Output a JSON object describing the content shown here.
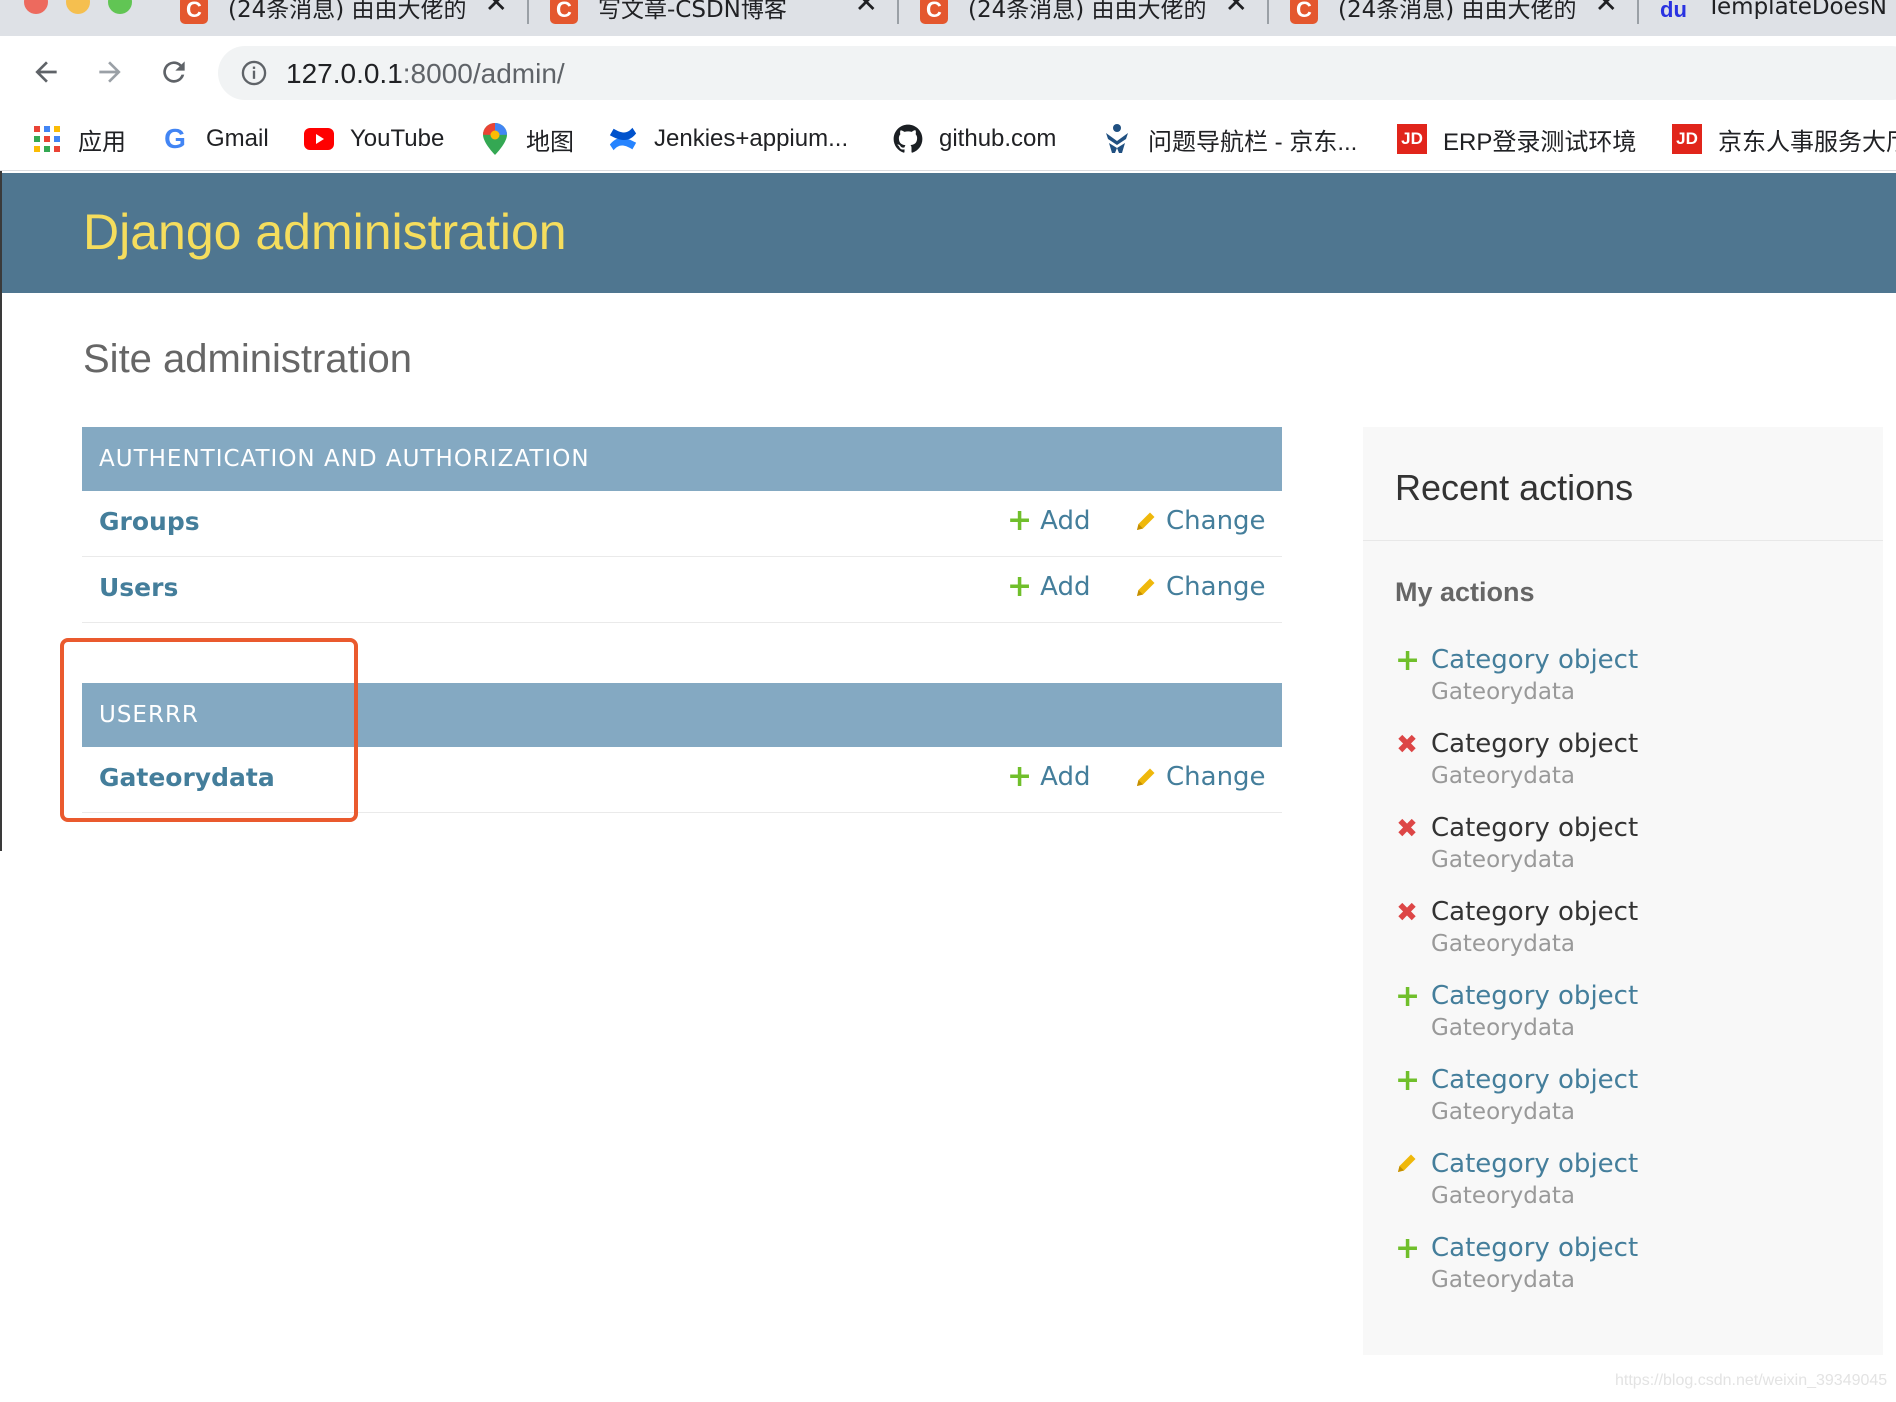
{
  "browser": {
    "tabs": [
      {
        "title": "(24条消息) 由由大佬的",
        "favicon": "C"
      },
      {
        "title": "写文章-CSDN博客",
        "favicon": "C"
      },
      {
        "title": "(24条消息) 由由大佬的",
        "favicon": "C"
      },
      {
        "title": "(24条消息) 由由大佬的",
        "favicon": "C"
      },
      {
        "title": "TemplateDoesN",
        "favicon": "du"
      }
    ],
    "url_host": "127.0.0.1",
    "url_path": ":8000/admin/",
    "bookmarks": [
      {
        "label": "应用",
        "icon": "apps-grid-icon"
      },
      {
        "label": "Gmail",
        "icon": "google-icon"
      },
      {
        "label": "YouTube",
        "icon": "youtube-icon"
      },
      {
        "label": "地图",
        "icon": "maps-pin-icon"
      },
      {
        "label": "Jenkies+appium...",
        "icon": "confluence-icon"
      },
      {
        "label": "github.com",
        "icon": "github-icon"
      },
      {
        "label": "问题导航栏 - 京东...",
        "icon": "jira-icon"
      },
      {
        "label": "ERP登录测试环境",
        "icon": "jd-icon"
      },
      {
        "label": "京东人事服务大厅",
        "icon": "jd-icon"
      }
    ],
    "jd_badge": "JD"
  },
  "admin": {
    "branding": "Django administration",
    "page_title": "Site administration",
    "colors": {
      "header": "#4f7690",
      "branding": "#f5dd5d",
      "caption": "#84a9c2",
      "link": "#447e9b",
      "add_green": "#70bf2b",
      "delete_red": "#dd4646",
      "change_yellow": "#efb80b",
      "highlight": "#ea5a2e"
    },
    "modules": [
      {
        "caption": "AUTHENTICATION AND AUTHORIZATION",
        "models": [
          {
            "name": "Groups",
            "add": "Add",
            "change": "Change"
          },
          {
            "name": "Users",
            "add": "Add",
            "change": "Change"
          }
        ]
      },
      {
        "caption": "USERRR",
        "models": [
          {
            "name": "Gateorydata",
            "add": "Add",
            "change": "Change"
          }
        ]
      }
    ],
    "recent": {
      "title": "Recent actions",
      "subtitle": "My actions",
      "actions": [
        {
          "type": "addition",
          "name": "Category object",
          "model": "Gateorydata"
        },
        {
          "type": "deletion",
          "name": "Category object",
          "model": "Gateorydata"
        },
        {
          "type": "deletion",
          "name": "Category object",
          "model": "Gateorydata"
        },
        {
          "type": "deletion",
          "name": "Category object",
          "model": "Gateorydata"
        },
        {
          "type": "addition",
          "name": "Category object",
          "model": "Gateorydata"
        },
        {
          "type": "addition",
          "name": "Category object",
          "model": "Gateorydata"
        },
        {
          "type": "change",
          "name": "Category object",
          "model": "Gateorydata"
        },
        {
          "type": "addition",
          "name": "Category object",
          "model": "Gateorydata"
        }
      ]
    }
  },
  "watermark": "https://blog.csdn.net/weixin_39349045"
}
